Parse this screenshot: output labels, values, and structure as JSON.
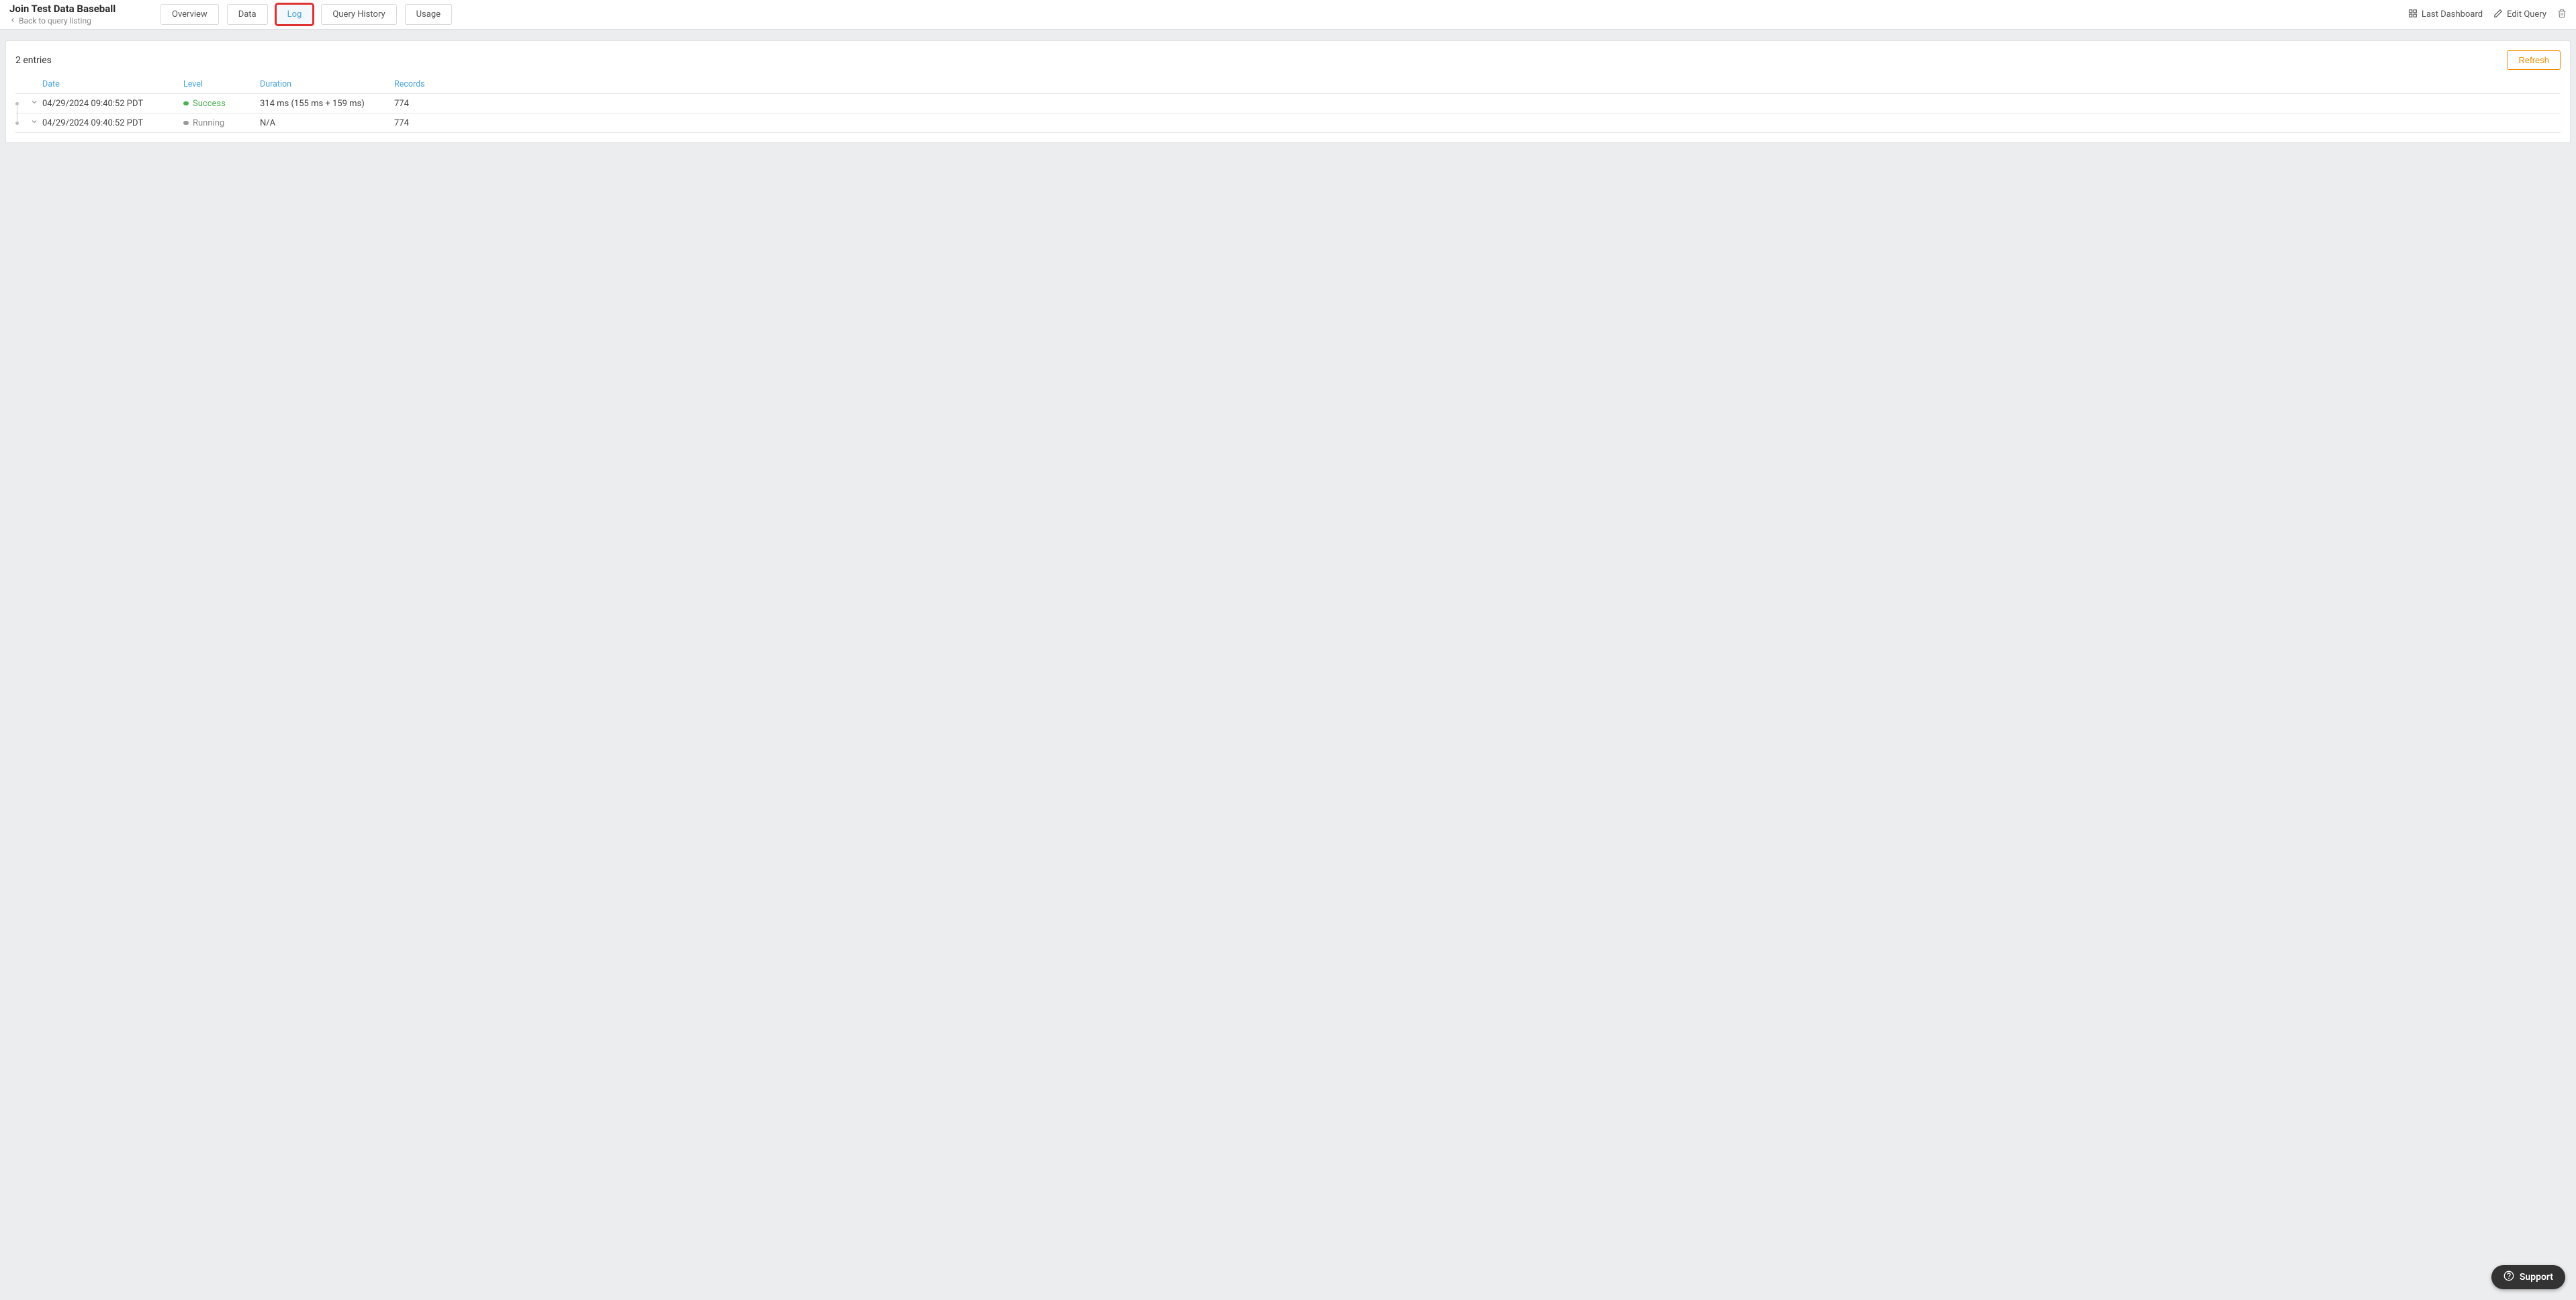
{
  "header": {
    "title": "Join Test Data Baseball",
    "back_label": "Back to query listing",
    "tabs": [
      {
        "label": "Overview",
        "active": false,
        "highlight": false
      },
      {
        "label": "Data",
        "active": false,
        "highlight": false
      },
      {
        "label": "Log",
        "active": true,
        "highlight": true
      },
      {
        "label": "Query History",
        "active": false,
        "highlight": false
      },
      {
        "label": "Usage",
        "active": false,
        "highlight": false
      }
    ],
    "actions": {
      "last_dashboard": "Last Dashboard",
      "edit_query": "Edit Query"
    }
  },
  "log": {
    "entries_label": "2 entries",
    "refresh_label": "Refresh",
    "columns": {
      "date": "Date",
      "level": "Level",
      "duration": "Duration",
      "records": "Records"
    },
    "rows": [
      {
        "date": "04/29/2024 09:40:52 PDT",
        "level": "Success",
        "level_kind": "success",
        "duration": "314 ms (155 ms + 159 ms)",
        "records": "774"
      },
      {
        "date": "04/29/2024 09:40:52 PDT",
        "level": "Running",
        "level_kind": "running",
        "duration": "N/A",
        "records": "774"
      }
    ]
  },
  "support": {
    "label": "Support"
  }
}
